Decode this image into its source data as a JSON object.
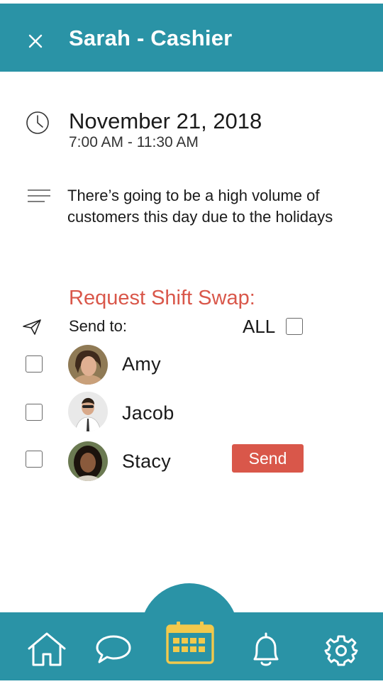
{
  "header": {
    "title": "Sarah - Cashier",
    "close_icon": "close-icon"
  },
  "shift": {
    "date": "November 21, 2018",
    "time": "7:00 AM - 11:30 AM",
    "notes": "There’s going to be a high volume of customers this day due to the holidays"
  },
  "swap": {
    "title": "Request Shift Swap:",
    "send_to_label": "Send to:",
    "all_label": "ALL",
    "send_button": "Send",
    "people": [
      {
        "name": "Amy"
      },
      {
        "name": "Jacob"
      },
      {
        "name": "Stacy"
      }
    ]
  },
  "nav": {
    "items": [
      "home-icon",
      "chat-icon",
      "calendar-icon",
      "bell-icon",
      "settings-icon"
    ],
    "active": "calendar-icon"
  },
  "colors": {
    "primary": "#2a93a6",
    "accent": "#d9574a",
    "active_icon": "#f2c94c",
    "inactive_icon": "#ffffff"
  }
}
